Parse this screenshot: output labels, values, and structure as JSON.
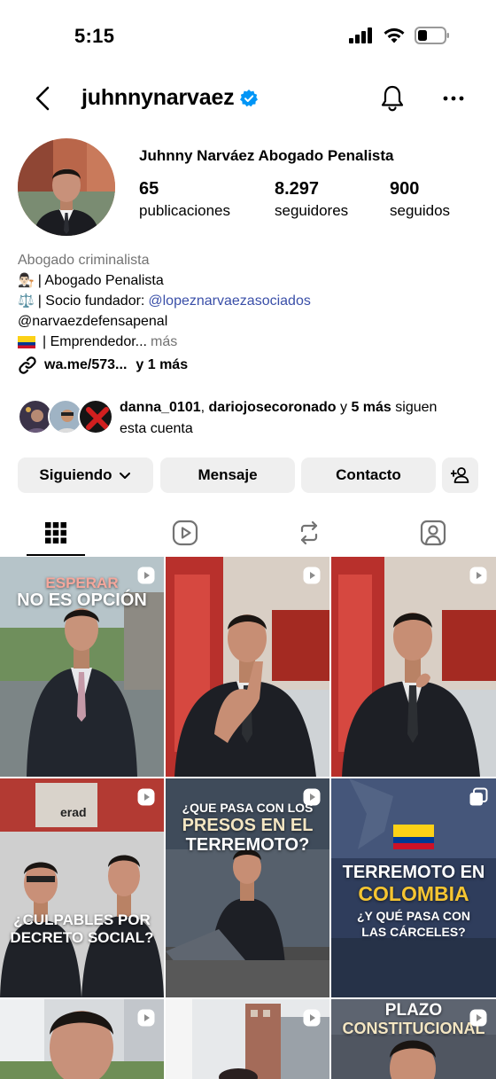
{
  "status_bar": {
    "time": "5:15"
  },
  "header": {
    "username": "juhnnynarvaez"
  },
  "profile": {
    "display_name": "Juhnny Narváez Abogado Penalista",
    "stats": [
      {
        "value": "65",
        "label": "publicaciones"
      },
      {
        "value": "8.297",
        "label": "seguidores"
      },
      {
        "value": "900",
        "label": "seguidos"
      }
    ],
    "category": "Abogado criminalista",
    "bio": {
      "line1_emoji": "👨🏻‍⚖️",
      "line1_text": "| Abogado Penalista",
      "line2_emoji": "⚖️",
      "line2_text": "| Socio fundador:",
      "line2_mention": "@lopeznarvaezasociados",
      "line3_text": "@narvaezdefensapenal",
      "line4_text": "| Emprendedor...",
      "line4_more": "más"
    },
    "link_text": "wa.me/573...",
    "link_more": "y 1 más",
    "followed_by": {
      "user1": "danna_0101",
      "sep": ",",
      "user2": "dariojosecoronado",
      "and": "y",
      "count": "5 más",
      "suffix1": "siguen",
      "suffix2": "esta cuenta"
    }
  },
  "buttons": {
    "following": "Siguiendo",
    "message": "Mensaje",
    "contact": "Contacto"
  },
  "posts": {
    "p1_line1": "ESPERAR",
    "p1_line2": "NO ES OPCIÓN",
    "p5_line1": "¿QUE PASA CON LOS",
    "p5_line2": "PRESOS EN EL",
    "p5_line3": "TERREMOTO?",
    "p4_line1": "¿CULPABLES POR",
    "p4_line2": "DECRETO SOCIAL?",
    "p6_line1": "TERREMOTO EN",
    "p6_line2": "COLOMBIA",
    "p6_line3": "¿Y QUÉ PASA CON",
    "p6_line4": "LAS CÁRCELES?",
    "p9_line1": "PLAZO",
    "p9_line2": "CONSTITUCIONAL",
    "p4_sign": "erad"
  },
  "colors": {
    "verified": "#0095f6",
    "button_bg": "#efefef",
    "mention": "#3a4fa8",
    "secondary_text": "#737373"
  }
}
